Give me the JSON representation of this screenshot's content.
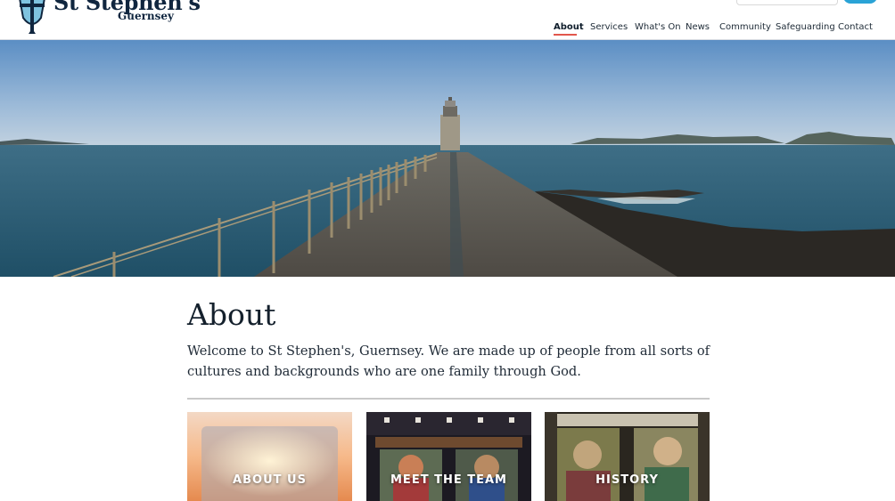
{
  "site": {
    "name": "St Stephen's",
    "location": "Guernsey"
  },
  "nav": {
    "items": [
      {
        "label": "About",
        "active": true
      },
      {
        "label": "Services",
        "active": false
      },
      {
        "label": "What's On",
        "active": false
      },
      {
        "label": "News",
        "active": false
      },
      {
        "label": "Community",
        "active": false
      },
      {
        "label": "Safeguarding",
        "active": false
      },
      {
        "label": "Contact",
        "active": false
      }
    ]
  },
  "hero": {
    "image": "lighthouse-pier-photo"
  },
  "main": {
    "title": "About",
    "intro": "Welcome to St Stephen's, Guernsey. We are made up of people from all sorts of cultures and backgrounds who are one family through God."
  },
  "cards": [
    {
      "label": "ABOUT US",
      "image": "sunset-photo"
    },
    {
      "label": "MEET THE TEAM",
      "image": "stained-glass-photo"
    },
    {
      "label": "HISTORY",
      "image": "stained-glass-photo"
    }
  ],
  "colors": {
    "brand_navy": "#10263f",
    "brand_blue": "#2aa3d6",
    "active_underline": "#e2574c",
    "text": "#1f2a36"
  }
}
